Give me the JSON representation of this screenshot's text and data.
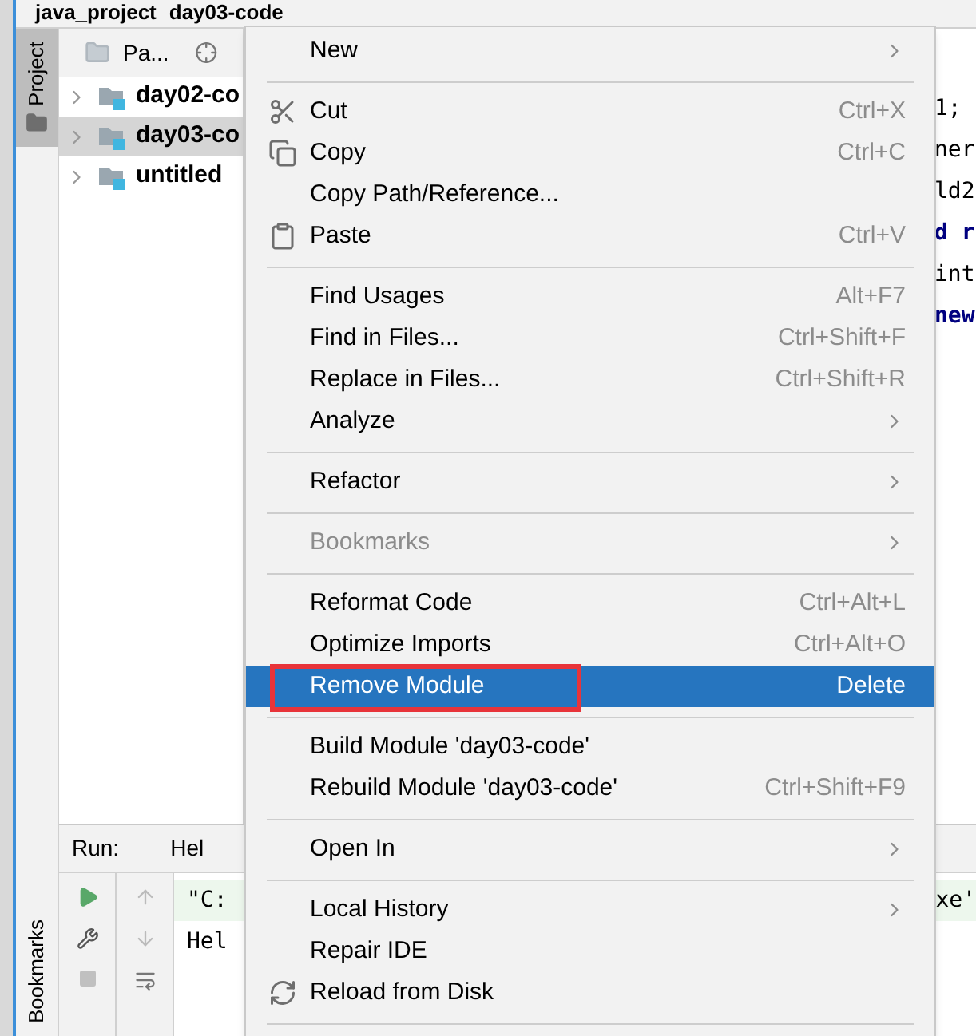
{
  "breadcrumb": [
    "java_project",
    "day03-code"
  ],
  "tool_stripe": {
    "top_tab": {
      "label": "Project",
      "selected": true
    },
    "bottom_tab": {
      "label": "Bookmarks",
      "selected": false
    }
  },
  "project_panel": {
    "header": "Pa...",
    "tree": [
      {
        "label": "day02-co",
        "selected": false
      },
      {
        "label": "day03-co",
        "selected": true
      },
      {
        "label": "untitled",
        "selected": false
      }
    ]
  },
  "editor_lines": [
    {
      "text": "1;",
      "kind": "plain"
    },
    {
      "text": "ner",
      "kind": "plain"
    },
    {
      "text": "ld2",
      "kind": "plain"
    },
    {
      "text": "d r",
      "kind": "keyword"
    },
    {
      "text": "int",
      "kind": "plain"
    },
    {
      "text": "new",
      "kind": "keyword"
    }
  ],
  "run_panel": {
    "label": "Run:",
    "tab": "Hel",
    "console": [
      {
        "text": "\"C:",
        "kind": "command"
      },
      {
        "text": "Hel",
        "kind": "plain"
      }
    ],
    "console_tail": "xe'"
  },
  "context_menu": [
    {
      "kind": "item",
      "label": "New",
      "submenu": true,
      "disabled": false,
      "selected": false,
      "annotated": false
    },
    {
      "kind": "separator"
    },
    {
      "kind": "scissors",
      "label": "Cut",
      "shortcut": "Ctrl+X",
      "submenu": false,
      "disabled": false,
      "selected": false,
      "annotated": false
    },
    {
      "kind": "copy",
      "label": "Copy",
      "shortcut": "Ctrl+C",
      "submenu": false,
      "disabled": false,
      "selected": false,
      "annotated": false
    },
    {
      "kind": "item",
      "label": "Copy Path/Reference...",
      "submenu": false,
      "disabled": false,
      "selected": false,
      "annotated": false
    },
    {
      "kind": "clipboard",
      "label": "Paste",
      "shortcut": "Ctrl+V",
      "submenu": false,
      "disabled": false,
      "selected": false,
      "annotated": false
    },
    {
      "kind": "separator"
    },
    {
      "kind": "item",
      "label": "Find Usages",
      "shortcut": "Alt+F7",
      "submenu": false,
      "disabled": false,
      "selected": false,
      "annotated": false
    },
    {
      "kind": "item",
      "label": "Find in Files...",
      "shortcut": "Ctrl+Shift+F",
      "submenu": false,
      "disabled": false,
      "selected": false,
      "annotated": false
    },
    {
      "kind": "item",
      "label": "Replace in Files...",
      "shortcut": "Ctrl+Shift+R",
      "submenu": false,
      "disabled": false,
      "selected": false,
      "annotated": false
    },
    {
      "kind": "item",
      "label": "Analyze",
      "submenu": true,
      "disabled": false,
      "selected": false,
      "annotated": false
    },
    {
      "kind": "separator"
    },
    {
      "kind": "item",
      "label": "Refactor",
      "submenu": true,
      "disabled": false,
      "selected": false,
      "annotated": false
    },
    {
      "kind": "separator"
    },
    {
      "kind": "item",
      "label": "Bookmarks",
      "submenu": true,
      "disabled": true,
      "selected": false,
      "annotated": false
    },
    {
      "kind": "separator"
    },
    {
      "kind": "item",
      "label": "Reformat Code",
      "shortcut": "Ctrl+Alt+L",
      "submenu": false,
      "disabled": false,
      "selected": false,
      "annotated": false
    },
    {
      "kind": "item",
      "label": "Optimize Imports",
      "shortcut": "Ctrl+Alt+O",
      "submenu": false,
      "disabled": false,
      "selected": false,
      "annotated": false
    },
    {
      "kind": "item",
      "label": "Remove Module",
      "shortcut": "Delete",
      "submenu": false,
      "disabled": false,
      "selected": true,
      "annotated": true
    },
    {
      "kind": "separator"
    },
    {
      "kind": "item",
      "label": "Build Module 'day03-code'",
      "submenu": false,
      "disabled": false,
      "selected": false,
      "annotated": false
    },
    {
      "kind": "item",
      "label": "Rebuild Module 'day03-code'",
      "shortcut": "Ctrl+Shift+F9",
      "submenu": false,
      "disabled": false,
      "selected": false,
      "annotated": false
    },
    {
      "kind": "separator"
    },
    {
      "kind": "item",
      "label": "Open In",
      "submenu": true,
      "disabled": false,
      "selected": false,
      "annotated": false
    },
    {
      "kind": "separator"
    },
    {
      "kind": "item",
      "label": "Local History",
      "submenu": true,
      "disabled": false,
      "selected": false,
      "annotated": false
    },
    {
      "kind": "item",
      "label": "Repair IDE",
      "submenu": false,
      "disabled": false,
      "selected": false,
      "annotated": false
    },
    {
      "kind": "reload",
      "label": "Reload from Disk",
      "submenu": false,
      "disabled": false,
      "selected": false,
      "annotated": false
    },
    {
      "kind": "separator"
    }
  ]
}
